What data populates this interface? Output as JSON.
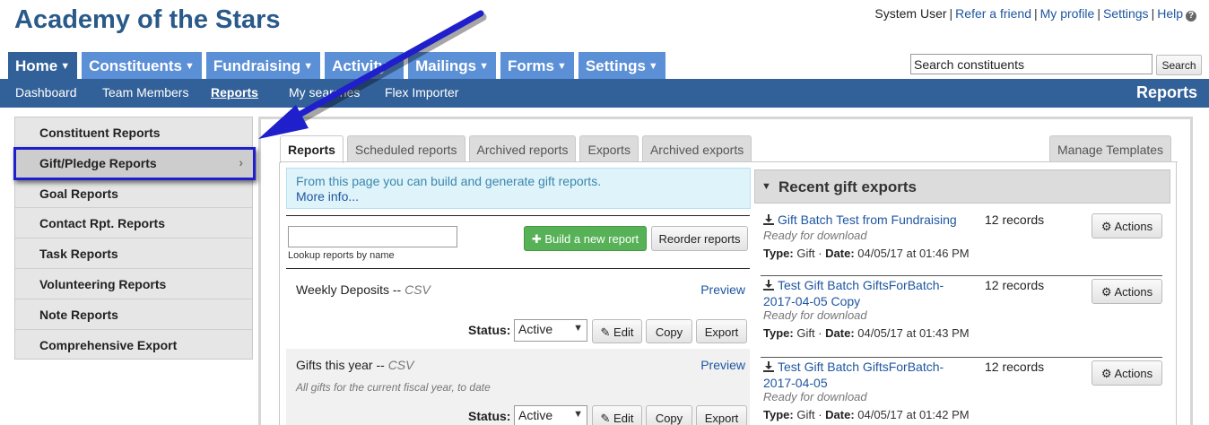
{
  "app": {
    "title": "Academy of the Stars"
  },
  "util": {
    "user": "System User",
    "refer": "Refer a friend",
    "profile": "My profile",
    "settings": "Settings",
    "help": "Help"
  },
  "main_nav": [
    {
      "label": "Home",
      "active": true
    },
    {
      "label": "Constituents"
    },
    {
      "label": "Fundraising"
    },
    {
      "label": "Activity"
    },
    {
      "label": "Mailings"
    },
    {
      "label": "Forms"
    },
    {
      "label": "Settings"
    }
  ],
  "search": {
    "value": "Search constituents",
    "button": "Search"
  },
  "sub_nav": {
    "items": [
      "Dashboard",
      "Team Members",
      "Reports",
      "My searches",
      "Flex Importer"
    ],
    "active": "Reports",
    "page_title": "Reports"
  },
  "sidebar": [
    "Constituent Reports",
    "Gift/Pledge Reports",
    "Goal Reports",
    "Contact Rpt. Reports",
    "Task Reports",
    "Volunteering Reports",
    "Note Reports",
    "Comprehensive Export"
  ],
  "tabs": [
    "Reports",
    "Scheduled reports",
    "Archived reports",
    "Exports",
    "Archived exports"
  ],
  "manage_templates": "Manage Templates",
  "info": {
    "text": "From this page you can build and generate gift reports.",
    "more": "More info..."
  },
  "lookup": {
    "caption": "Lookup reports by name"
  },
  "buttons": {
    "build": "Build a new report",
    "reorder": "Reorder reports"
  },
  "reports": [
    {
      "name": "Weekly Deposits --",
      "format": "CSV",
      "description": "",
      "status": "Active"
    },
    {
      "name": "Gifts this year --",
      "format": "CSV",
      "description": "All gifts for the current fiscal year, to date",
      "status": "Active"
    }
  ],
  "report_labels": {
    "preview": "Preview",
    "status": "Status:",
    "edit": "Edit",
    "copy": "Copy",
    "export": "Export"
  },
  "exports": {
    "title": "Recent gift exports",
    "actions_label": "Actions",
    "type_label": "Type:",
    "date_label": "Date:",
    "items": [
      {
        "name": "Gift Batch Test from Fundraising",
        "records": "12 records",
        "status": "Ready for download",
        "type": "Gift",
        "date": "04/05/17 at 01:46 PM"
      },
      {
        "name": "Test Gift Batch GiftsForBatch-2017-04-05 Copy",
        "records": "12 records",
        "status": "Ready for download",
        "type": "Gift",
        "date": "04/05/17 at 01:43 PM"
      },
      {
        "name": "Test Gift Batch GiftsForBatch-2017-04-05",
        "records": "12 records",
        "status": "Ready for download",
        "type": "Gift",
        "date": "04/05/17 at 01:42 PM"
      }
    ]
  },
  "colors": {
    "brand": "#2a5a8a",
    "nav_tab": "#5b8fd6",
    "nav_active": "#326098",
    "annotation": "#1f1fcc",
    "success": "#57b257"
  }
}
